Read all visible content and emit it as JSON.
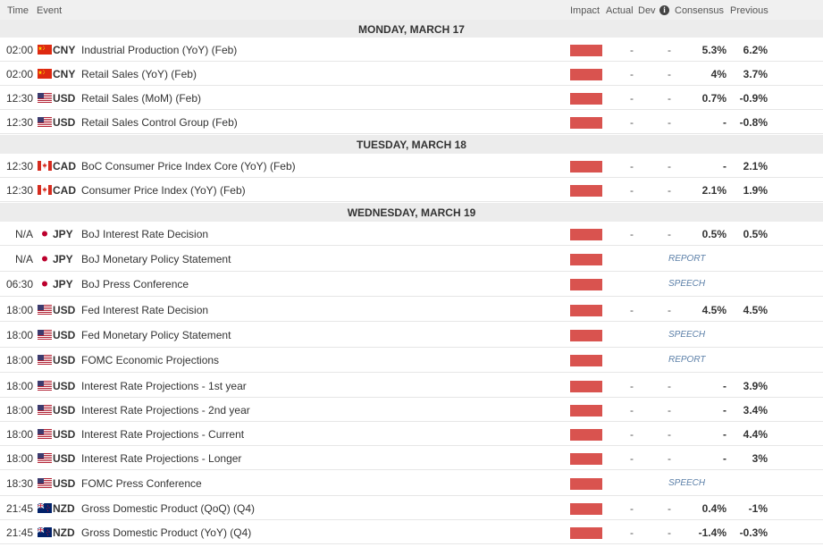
{
  "header": {
    "time": "Time",
    "event": "Event",
    "impact": "Impact",
    "actual": "Actual",
    "dev": "Dev",
    "info_icon": "i",
    "consensus": "Consensus",
    "previous": "Previous"
  },
  "colors": {
    "impact_high": "#d9534f",
    "tag": "#5b7fa8"
  },
  "days": [
    {
      "label": "MONDAY, MARCH 17"
    },
    {
      "label": "TUESDAY, MARCH 18"
    },
    {
      "label": "WEDNESDAY, MARCH 19"
    }
  ],
  "events": [
    {
      "day": 0,
      "time": "02:00",
      "flag": "china-flag-icon",
      "currency": "CNY",
      "event": "Industrial Production (YoY) (Feb)",
      "impact": "high",
      "actual": "-",
      "dev": "-",
      "consensus": "5.3%",
      "previous": "6.2%"
    },
    {
      "day": 0,
      "time": "02:00",
      "flag": "china-flag-icon",
      "currency": "CNY",
      "event": "Retail Sales (YoY) (Feb)",
      "impact": "high",
      "actual": "-",
      "dev": "-",
      "consensus": "4%",
      "previous": "3.7%"
    },
    {
      "day": 0,
      "time": "12:30",
      "flag": "usa-flag-icon",
      "currency": "USD",
      "event": "Retail Sales (MoM) (Feb)",
      "impact": "high",
      "actual": "-",
      "dev": "-",
      "consensus": "0.7%",
      "previous": "-0.9%"
    },
    {
      "day": 0,
      "time": "12:30",
      "flag": "usa-flag-icon",
      "currency": "USD",
      "event": "Retail Sales Control Group (Feb)",
      "impact": "high",
      "actual": "-",
      "dev": "-",
      "consensus": "-",
      "previous": "-0.8%"
    },
    {
      "day": 1,
      "time": "12:30",
      "flag": "canada-flag-icon",
      "currency": "CAD",
      "event": "BoC Consumer Price Index Core (YoY) (Feb)",
      "impact": "high",
      "actual": "-",
      "dev": "-",
      "consensus": "-",
      "previous": "2.1%"
    },
    {
      "day": 1,
      "time": "12:30",
      "flag": "canada-flag-icon",
      "currency": "CAD",
      "event": "Consumer Price Index (YoY) (Feb)",
      "impact": "high",
      "actual": "-",
      "dev": "-",
      "consensus": "2.1%",
      "previous": "1.9%"
    },
    {
      "day": 2,
      "time": "N/A",
      "flag": "japan-flag-icon",
      "currency": "JPY",
      "event": "BoJ Interest Rate Decision",
      "impact": "high",
      "actual": "-",
      "dev": "-",
      "consensus": "0.5%",
      "previous": "0.5%"
    },
    {
      "day": 2,
      "time": "N/A",
      "flag": "japan-flag-icon",
      "currency": "JPY",
      "event": "BoJ Monetary Policy Statement",
      "impact": "high",
      "tag": "REPORT"
    },
    {
      "day": 2,
      "time": "06:30",
      "flag": "japan-flag-icon",
      "currency": "JPY",
      "event": "BoJ Press Conference",
      "impact": "high",
      "tag": "SPEECH"
    },
    {
      "day": 2,
      "time": "18:00",
      "flag": "usa-flag-icon",
      "currency": "USD",
      "event": "Fed Interest Rate Decision",
      "impact": "high",
      "actual": "-",
      "dev": "-",
      "consensus": "4.5%",
      "previous": "4.5%"
    },
    {
      "day": 2,
      "time": "18:00",
      "flag": "usa-flag-icon",
      "currency": "USD",
      "event": "Fed Monetary Policy Statement",
      "impact": "high",
      "tag": "SPEECH"
    },
    {
      "day": 2,
      "time": "18:00",
      "flag": "usa-flag-icon",
      "currency": "USD",
      "event": "FOMC Economic Projections",
      "impact": "high",
      "tag": "REPORT"
    },
    {
      "day": 2,
      "time": "18:00",
      "flag": "usa-flag-icon",
      "currency": "USD",
      "event": "Interest Rate Projections - 1st year",
      "impact": "high",
      "actual": "-",
      "dev": "-",
      "consensus": "-",
      "previous": "3.9%"
    },
    {
      "day": 2,
      "time": "18:00",
      "flag": "usa-flag-icon",
      "currency": "USD",
      "event": "Interest Rate Projections - 2nd year",
      "impact": "high",
      "actual": "-",
      "dev": "-",
      "consensus": "-",
      "previous": "3.4%"
    },
    {
      "day": 2,
      "time": "18:00",
      "flag": "usa-flag-icon",
      "currency": "USD",
      "event": "Interest Rate Projections - Current",
      "impact": "high",
      "actual": "-",
      "dev": "-",
      "consensus": "-",
      "previous": "4.4%"
    },
    {
      "day": 2,
      "time": "18:00",
      "flag": "usa-flag-icon",
      "currency": "USD",
      "event": "Interest Rate Projections - Longer",
      "impact": "high",
      "actual": "-",
      "dev": "-",
      "consensus": "-",
      "previous": "3%"
    },
    {
      "day": 2,
      "time": "18:30",
      "flag": "usa-flag-icon",
      "currency": "USD",
      "event": "FOMC Press Conference",
      "impact": "high",
      "tag": "SPEECH"
    },
    {
      "day": 2,
      "time": "21:45",
      "flag": "new-zealand-flag-icon",
      "currency": "NZD",
      "event": "Gross Domestic Product (QoQ) (Q4)",
      "impact": "high",
      "actual": "-",
      "dev": "-",
      "consensus": "0.4%",
      "previous": "-1%"
    },
    {
      "day": 2,
      "time": "21:45",
      "flag": "new-zealand-flag-icon",
      "currency": "NZD",
      "event": "Gross Domestic Product (YoY) (Q4)",
      "impact": "high",
      "actual": "-",
      "dev": "-",
      "consensus": "-1.4%",
      "previous": "-0.3%"
    }
  ]
}
